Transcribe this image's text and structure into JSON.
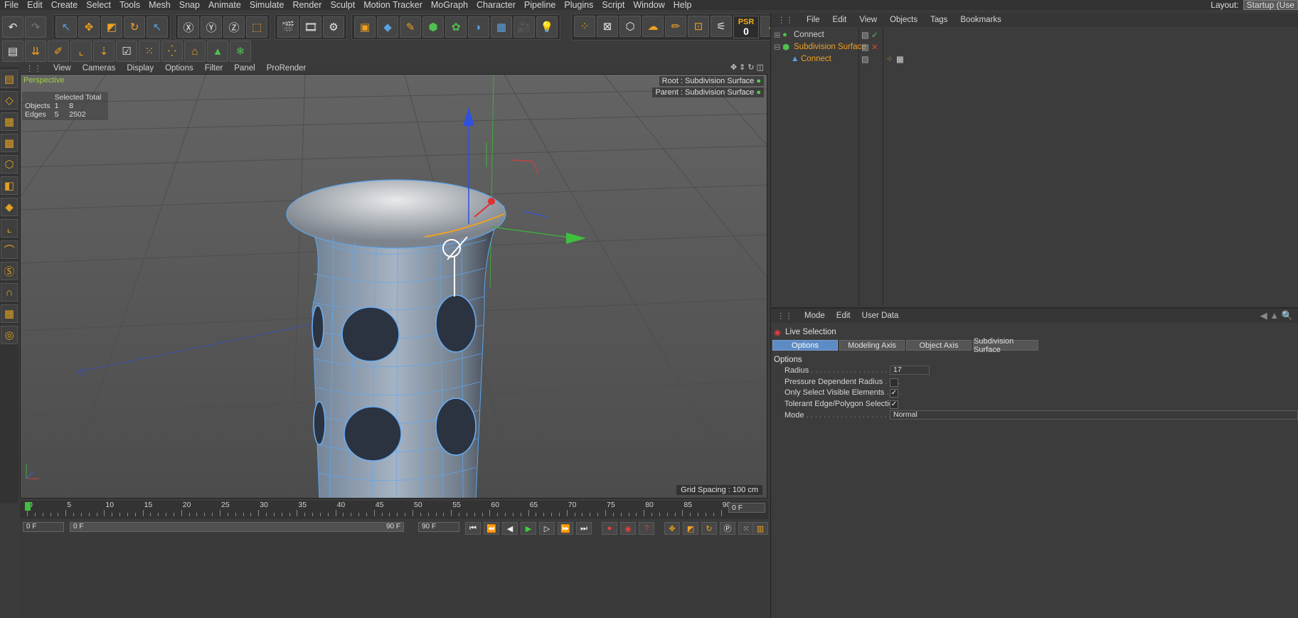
{
  "menubar": {
    "items": [
      "File",
      "Edit",
      "Create",
      "Select",
      "Tools",
      "Mesh",
      "Snap",
      "Animate",
      "Simulate",
      "Render",
      "Sculpt",
      "Motion Tracker",
      "MoGraph",
      "Character",
      "Pipeline",
      "Plugins",
      "Script",
      "Window",
      "Help"
    ],
    "layout_label": "Layout:",
    "layout_value": "Startup (Use"
  },
  "toolbar": {
    "psr_label": "PSR",
    "psr_value": "0"
  },
  "viewport": {
    "menu": [
      "View",
      "Cameras",
      "Display",
      "Options",
      "Filter",
      "Panel",
      "ProRender"
    ],
    "view_name": "Perspective",
    "info": {
      "header": "Selected Total",
      "rows": [
        {
          "label": "Objects",
          "selected": "1",
          "total": "8"
        },
        {
          "label": "Edges",
          "selected": "5",
          "total": "2502"
        }
      ]
    },
    "root_label": "Root : Subdivision Surface",
    "parent_label": "Parent : Subdivision Surface",
    "grid_spacing": "Grid Spacing : 100 cm"
  },
  "timeline": {
    "ticks": [
      "0",
      "5",
      "10",
      "15",
      "20",
      "25",
      "30",
      "35",
      "40",
      "45",
      "50",
      "55",
      "60",
      "65",
      "70",
      "75",
      "80",
      "85",
      "90"
    ],
    "current_frame": "0 F"
  },
  "transport": {
    "start_field": "0 F",
    "range_start": "0 F",
    "range_end": "90 F",
    "end_field": "90 F"
  },
  "object_manager": {
    "menu": [
      "File",
      "Edit",
      "View",
      "Objects",
      "Tags",
      "Bookmarks"
    ],
    "objects": [
      {
        "name": "Connect",
        "color": "#d8d8d8"
      },
      {
        "name": "Subdivision Surface",
        "color": "#f0a020"
      },
      {
        "name": "Connect",
        "color": "#f0a020"
      }
    ]
  },
  "attribute_manager": {
    "menu": [
      "Mode",
      "Edit",
      "User Data"
    ],
    "tool_name": "Live Selection",
    "tabs": [
      "Options",
      "Modeling Axis",
      "Object Axis",
      "Subdivision Surface"
    ],
    "active_tab": "Options",
    "section": "Options",
    "properties": [
      {
        "label": "Radius",
        "type": "number",
        "value": "17"
      },
      {
        "label": "Pressure Dependent Radius",
        "type": "checkbox",
        "checked": false
      },
      {
        "label": "Only Select Visible Elements",
        "type": "checkbox",
        "checked": true
      },
      {
        "label": "Tolerant Edge/Polygon Selection",
        "type": "checkbox",
        "checked": true
      },
      {
        "label": "Mode",
        "type": "select",
        "value": "Normal"
      }
    ]
  },
  "colors": {
    "accent": "#f0a020",
    "selection_blue": "#5d8bc4",
    "viewport_bg": "#5a5a5a"
  }
}
